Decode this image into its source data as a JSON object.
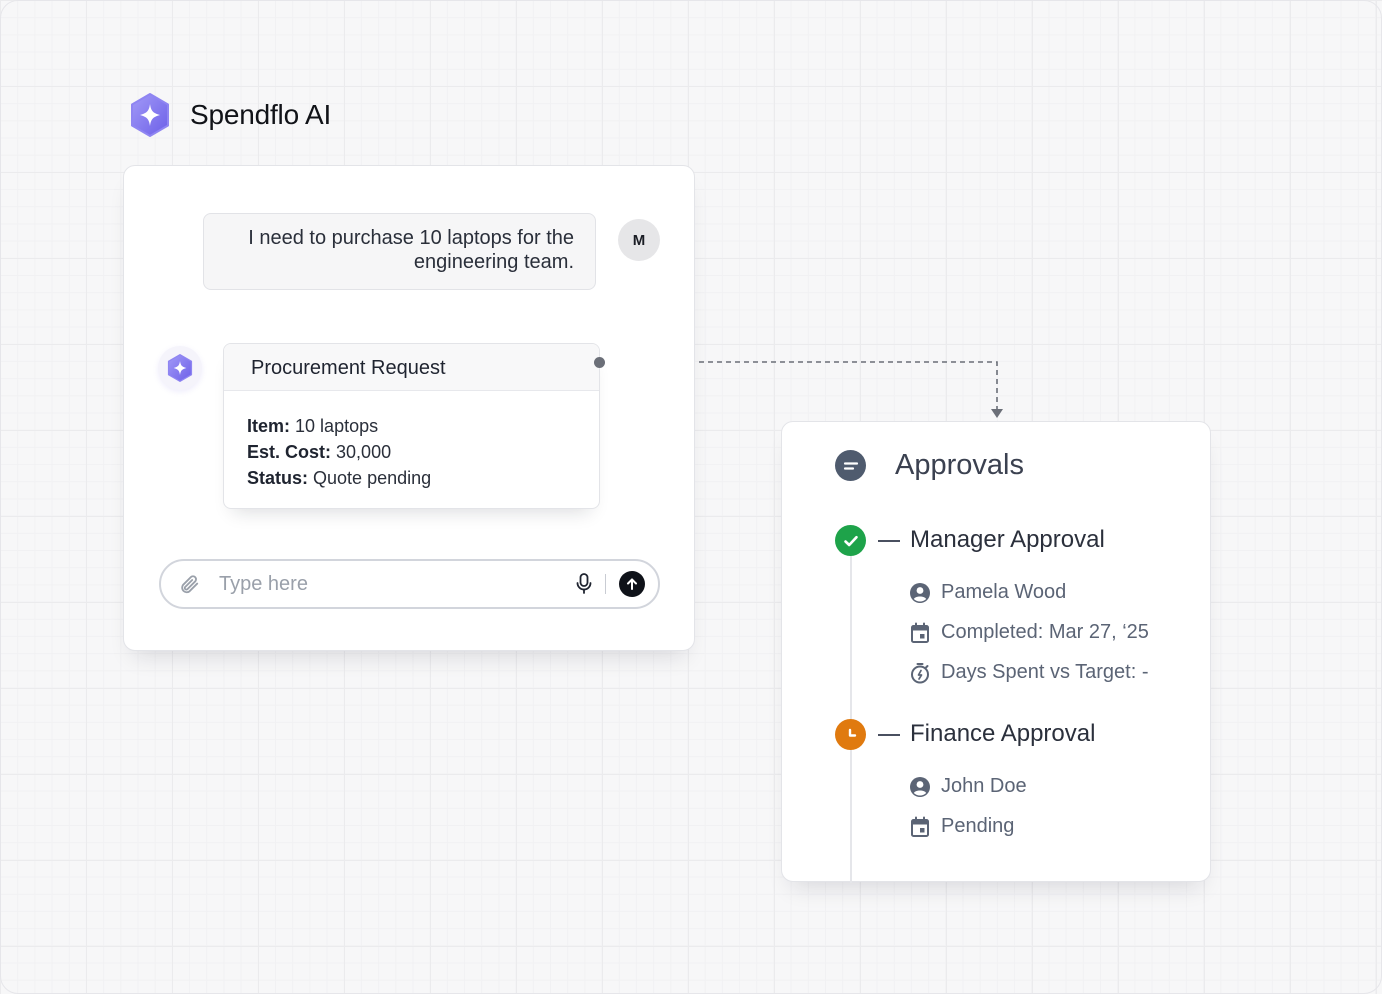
{
  "brand": {
    "name": "Spendflo AI",
    "icon": "sparkle-hexagon-icon",
    "color": "#7c6ef0"
  },
  "chat": {
    "user_message": "I need to purchase 10 laptops for the engineering team.",
    "user_avatar_initial": "M",
    "request_card": {
      "title": "Procurement Request",
      "fields": [
        {
          "label": "Item:",
          "value": "10 laptops"
        },
        {
          "label": "Est. Cost:",
          "value": "30,000"
        },
        {
          "label": "Status:",
          "value": "Quote pending"
        }
      ]
    },
    "input": {
      "placeholder": "Type here",
      "value": ""
    }
  },
  "approvals": {
    "title": "Approvals",
    "steps": [
      {
        "title": "Manager Approval",
        "status": "completed",
        "status_color": "#1ea34a",
        "details": [
          {
            "icon": "user-circle-icon",
            "text": "Pamela Wood"
          },
          {
            "icon": "calendar-icon",
            "text": "Completed: Mar 27, ‘25"
          },
          {
            "icon": "stopwatch-icon",
            "text": "Days Spent vs Target: -"
          }
        ]
      },
      {
        "title": "Finance Approval",
        "status": "pending",
        "status_color": "#e07a0f",
        "details": [
          {
            "icon": "user-circle-icon",
            "text": "John Doe"
          },
          {
            "icon": "calendar-icon",
            "text": "Pending"
          }
        ]
      }
    ]
  }
}
